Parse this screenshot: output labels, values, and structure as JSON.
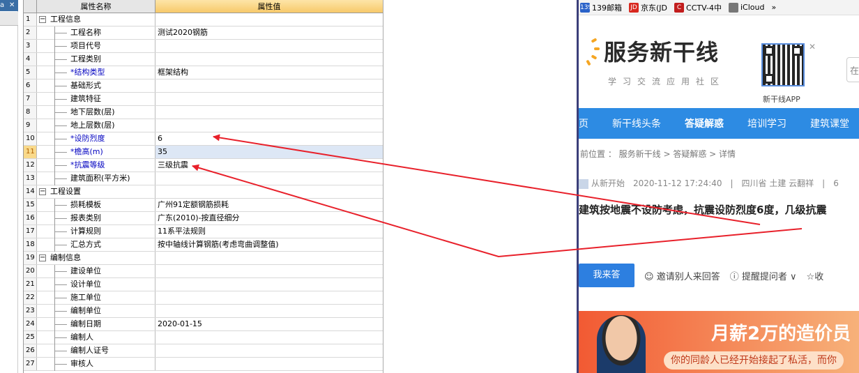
{
  "left_strip": {
    "close_icon": "✕",
    "title_fragment": "a"
  },
  "grid": {
    "header": {
      "col_name": "属性名称",
      "col_value": "属性值"
    },
    "rows": [
      {
        "num": "1",
        "name": "工程信息",
        "value": "",
        "group": true
      },
      {
        "num": "2",
        "name": "工程名称",
        "value": "测试2020钢筋"
      },
      {
        "num": "3",
        "name": "项目代号",
        "value": ""
      },
      {
        "num": "4",
        "name": "工程类别",
        "value": ""
      },
      {
        "num": "5",
        "name": "*结构类型",
        "value": "框架结构",
        "required": true
      },
      {
        "num": "6",
        "name": "基础形式",
        "value": ""
      },
      {
        "num": "7",
        "name": "建筑特征",
        "value": ""
      },
      {
        "num": "8",
        "name": "地下层数(层)",
        "value": ""
      },
      {
        "num": "9",
        "name": "地上层数(层)",
        "value": ""
      },
      {
        "num": "10",
        "name": "*设防烈度",
        "value": "6",
        "required": true
      },
      {
        "num": "11",
        "name": "*檐高(m)",
        "value": "35",
        "required": true,
        "selected": true
      },
      {
        "num": "12",
        "name": "*抗震等级",
        "value": "三级抗震",
        "required": true
      },
      {
        "num": "13",
        "name": "建筑面积(平方米)",
        "value": ""
      },
      {
        "num": "14",
        "name": "工程设置",
        "value": "",
        "group": true
      },
      {
        "num": "15",
        "name": "损耗模板",
        "value": "广州91定额钢筋损耗"
      },
      {
        "num": "16",
        "name": "报表类别",
        "value": "广东(2010)-按直径细分"
      },
      {
        "num": "17",
        "name": "计算规则",
        "value": "11系平法规则"
      },
      {
        "num": "18",
        "name": "汇总方式",
        "value": "按中轴线计算钢筋(考虑弯曲调整值)"
      },
      {
        "num": "19",
        "name": "编制信息",
        "value": "",
        "group": true
      },
      {
        "num": "20",
        "name": "建设单位",
        "value": ""
      },
      {
        "num": "21",
        "name": "设计单位",
        "value": ""
      },
      {
        "num": "22",
        "name": "施工单位",
        "value": ""
      },
      {
        "num": "23",
        "name": "编制单位",
        "value": ""
      },
      {
        "num": "24",
        "name": "编制日期",
        "value": "2020-01-15"
      },
      {
        "num": "25",
        "name": "编制人",
        "value": ""
      },
      {
        "num": "26",
        "name": "编制人证号",
        "value": ""
      },
      {
        "num": "27",
        "name": "审核人",
        "value": ""
      }
    ]
  },
  "browser": {
    "bookmarks": [
      {
        "icon": "139",
        "label": "139邮箱",
        "color": "#2a62c9"
      },
      {
        "icon": "JD",
        "label": "京东(JD",
        "color": "#d8281f"
      },
      {
        "icon": "C",
        "label": "CCTV-4中",
        "color": "#c21d1d"
      },
      {
        "icon": "",
        "label": "iCloud",
        "color": "#777777"
      }
    ],
    "bookmarks_more": "»",
    "logo_title": "服务新干线",
    "logo_subtitle": "学习交流应用社区",
    "qr_label": "新干线APP",
    "qr_close": "✕",
    "search_fragment": "在",
    "nav": [
      {
        "label": "页",
        "active": false
      },
      {
        "label": "新干线头条",
        "active": false
      },
      {
        "label": "答疑解惑",
        "active": true
      },
      {
        "label": "培训学习",
        "active": false
      },
      {
        "label": "建筑课堂",
        "active": false
      }
    ],
    "breadcrumb": "前位置 ： 服务新干线 > 答疑解惑 > 详情",
    "meta": {
      "author": "从新开始",
      "datetime": "2020-11-12 17:24:40",
      "sep1": "|",
      "location": "四川省 土建 云翻祥",
      "sep2": "|",
      "trail": "6"
    },
    "question_title": "建筑按地震不设防考虑，抗震设防烈度6度，几级抗震",
    "actions": {
      "answer": "我来答",
      "invite": "邀请别人来回答",
      "remind": "提醒提问者",
      "collect": "收"
    },
    "banner": {
      "headline": "月薪2万的造价员",
      "sub": "你的同龄人已经开始接起了私活，而你"
    }
  },
  "annotation": {
    "color": "#e8202a"
  }
}
